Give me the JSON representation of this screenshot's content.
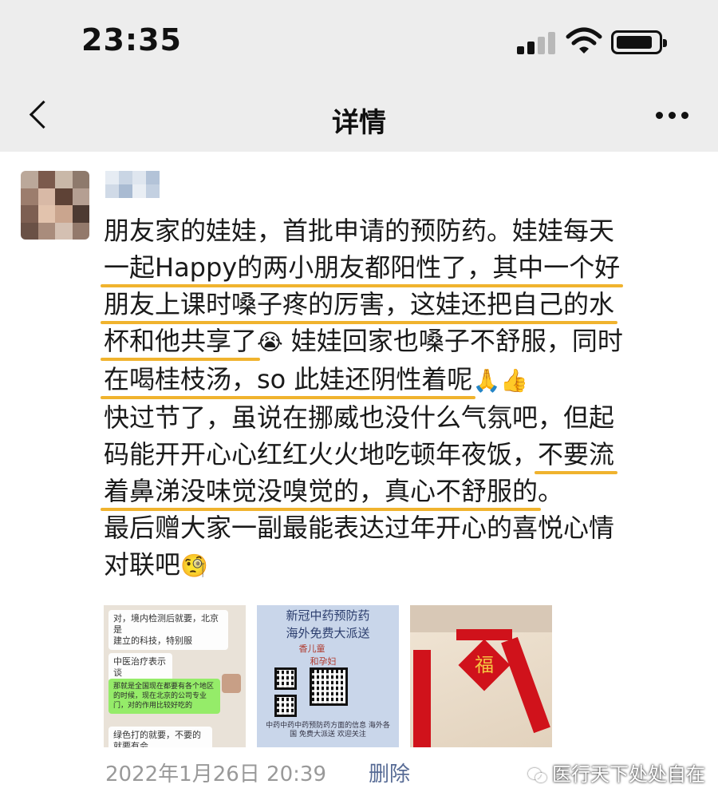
{
  "status_bar": {
    "time": "23:35"
  },
  "nav": {
    "title": "详情"
  },
  "post": {
    "lines": [
      "朋友家的娃娃，首批申请的预防药。娃娃每天",
      "一起Happy的两小朋友都阳性了，其中一个好",
      "朋友上课时嗓子疼的厉害，这娃还把自己的水",
      "杯和他共享了",
      "娃娃回家也嗓子不舒服，同时",
      "在喝桂枝汤，so 此娃还阴性着呢",
      "快过节了，虽说在挪威也没什么气氛吧，但起",
      "码能开开心心红红火火地吃顿年夜饭，",
      "不要流",
      "着鼻涕没味觉没嗅觉的，真心不舒服的",
      "。",
      "最后赠大家一副最能表达过年开心的喜悦心情",
      "对联吧"
    ],
    "emojis": {
      "laugh_cry": "😭",
      "pray_thumbs": "🙏👍",
      "smirk": "🧐"
    },
    "highlight_color": "#f0b32e"
  },
  "images": {
    "img1": {
      "lines": [
        "对，境内检测后就要，北京是",
        "建立的科技，特别服",
        "中医治疗表示谈",
        "那就是全国现在都要有各个地区的时候，现在北京的公司专业门，对的作用比较好吃的",
        "绿色打的就要，不要的就要有会"
      ]
    },
    "img2": {
      "title1": "新冠中药预防药",
      "title2": "海外免费大派送",
      "line3": "香儿童",
      "line4": "和孕妇",
      "caption": "中药中药中药预防药方面的信息 海外各国 免费大派送 欢迎关注"
    },
    "img3": {
      "chars": "福"
    }
  },
  "meta": {
    "timestamp": "2022年1月26日 20:39",
    "delete_label": "删除"
  },
  "watermark": {
    "text": "医行天下处处自在"
  },
  "colors": {
    "header_bg": "#ededed",
    "link": "#576b95",
    "meta_text": "#999999"
  }
}
